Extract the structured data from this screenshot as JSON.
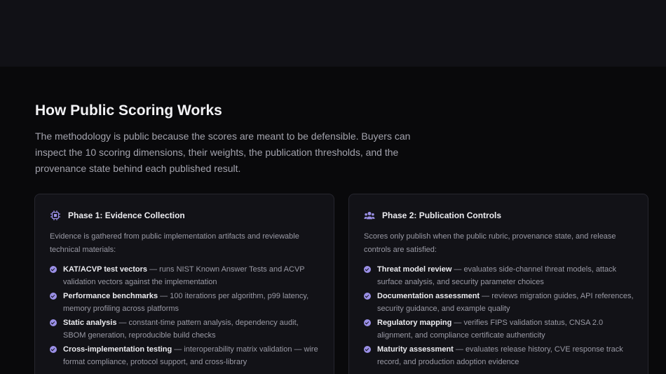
{
  "top": {
    "text": "",
    "link": ""
  },
  "section": {
    "title": "How Public Scoring Works",
    "intro": "The methodology is public because the scores are meant to be defensible. Buyers can inspect the 10 scoring dimensions, their weights, the publication thresholds, and the provenance state behind each published result."
  },
  "cards": [
    {
      "title": "Phase 1: Evidence Collection",
      "icon": "chip-icon",
      "desc": "Evidence is gathered from public implementation artifacts and reviewable technical materials:",
      "items": [
        {
          "label": "KAT/ACVP test vectors",
          "text": " — runs NIST Known Answer Tests and ACVP validation vectors against the implementation"
        },
        {
          "label": "Performance benchmarks",
          "text": " — 100 iterations per algorithm, p99 latency, memory profiling across platforms"
        },
        {
          "label": "Static analysis",
          "text": " — constant-time pattern analysis, dependency audit, SBOM generation, reproducible build checks"
        },
        {
          "label": "Cross-implementation testing",
          "text": " — interoperability matrix validation — wire format compliance, protocol support, and cross-library"
        }
      ]
    },
    {
      "title": "Phase 2: Publication Controls",
      "icon": "users-icon",
      "desc": "Scores only publish when the public rubric, provenance state, and release controls are satisfied:",
      "items": [
        {
          "label": "Threat model review",
          "text": " — evaluates side-channel threat models, attack surface analysis, and security parameter choices"
        },
        {
          "label": "Documentation assessment",
          "text": " — reviews migration guides, API references, security guidance, and example quality"
        },
        {
          "label": "Regulatory mapping",
          "text": " — verifies FIPS validation status, CNSA 2.0 alignment, and compliance certificate authenticity"
        },
        {
          "label": "Maturity assessment",
          "text": " — evaluates release history, CVE response track record, and production adoption evidence"
        }
      ]
    }
  ],
  "colors": {
    "accent": "#9a8fe6",
    "background": "#09090b",
    "card": "#121217"
  }
}
